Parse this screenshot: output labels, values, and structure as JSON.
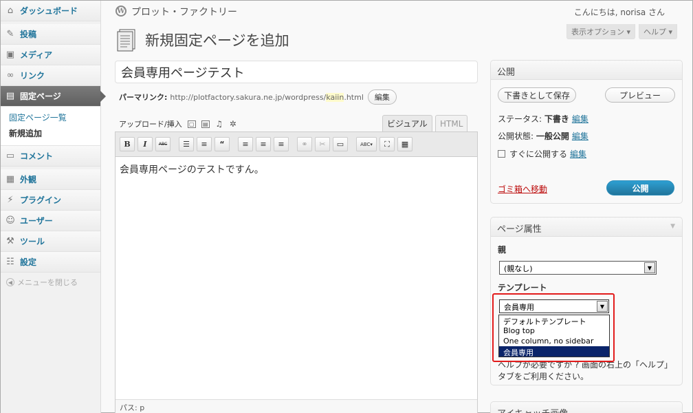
{
  "sidebar": {
    "items": [
      {
        "label": "ダッシュボード",
        "icon": "home-icon"
      },
      {
        "label": "投稿",
        "icon": "pin-icon"
      },
      {
        "label": "メディア",
        "icon": "media-icon"
      },
      {
        "label": "リンク",
        "icon": "link-icon"
      },
      {
        "label": "固定ページ",
        "icon": "page-icon"
      },
      {
        "label": "コメント",
        "icon": "comment-icon"
      },
      {
        "label": "外観",
        "icon": "appearance-icon"
      },
      {
        "label": "プラグイン",
        "icon": "plugin-icon"
      },
      {
        "label": "ユーザー",
        "icon": "users-icon"
      },
      {
        "label": "ツール",
        "icon": "tools-icon"
      },
      {
        "label": "設定",
        "icon": "settings-icon"
      }
    ],
    "submenu": [
      "固定ページ一覧",
      "新規追加"
    ],
    "collapse_label": "メニューを閉じる"
  },
  "header": {
    "site_name": "プロット・ファクトリー",
    "greeting": "こんにちは, norisa さん",
    "screen_options": "表示オプション ▾",
    "help": "ヘルプ ▾"
  },
  "page": {
    "title": "新規固定ページを追加"
  },
  "editor": {
    "title_value": "会員専用ページテスト",
    "permalink_label": "パーマリンク:",
    "permalink_url": "http://plotfactory.sakura.ne.jp/wordpress/",
    "permalink_slug": "kaiin",
    "permalink_ext": ".html",
    "edit_button": "編集",
    "upload_label": "アップロード/挿入",
    "tab_visual": "ビジュアル",
    "tab_html": "HTML",
    "content": "会員専用ページのテストですん。",
    "path": "パス: p"
  },
  "publish": {
    "heading": "公開",
    "save_draft": "下書きとして保存",
    "preview": "プレビュー",
    "status_label": "ステータス:",
    "status_value": "下書き",
    "visibility_label": "公開状態:",
    "visibility_value": "一般公開",
    "schedule_text": "すぐに公開する",
    "edit_link": "編集",
    "trash": "ゴミ箱へ移動",
    "publish_button": "公開"
  },
  "page_attributes": {
    "heading": "ページ属性",
    "parent_label": "親",
    "parent_value": "(親なし)",
    "template_label": "テンプレート",
    "template_value": "会員専用",
    "template_options": [
      "デフォルトテンプレート",
      "Blog top",
      "One column, no sidebar",
      "会員専用"
    ],
    "help_text": "ヘルプが必要ですか ? 画面の右上の「ヘルプ」タブをご利用ください。"
  },
  "eyecatch": {
    "heading": "アイキャッチ画像"
  }
}
